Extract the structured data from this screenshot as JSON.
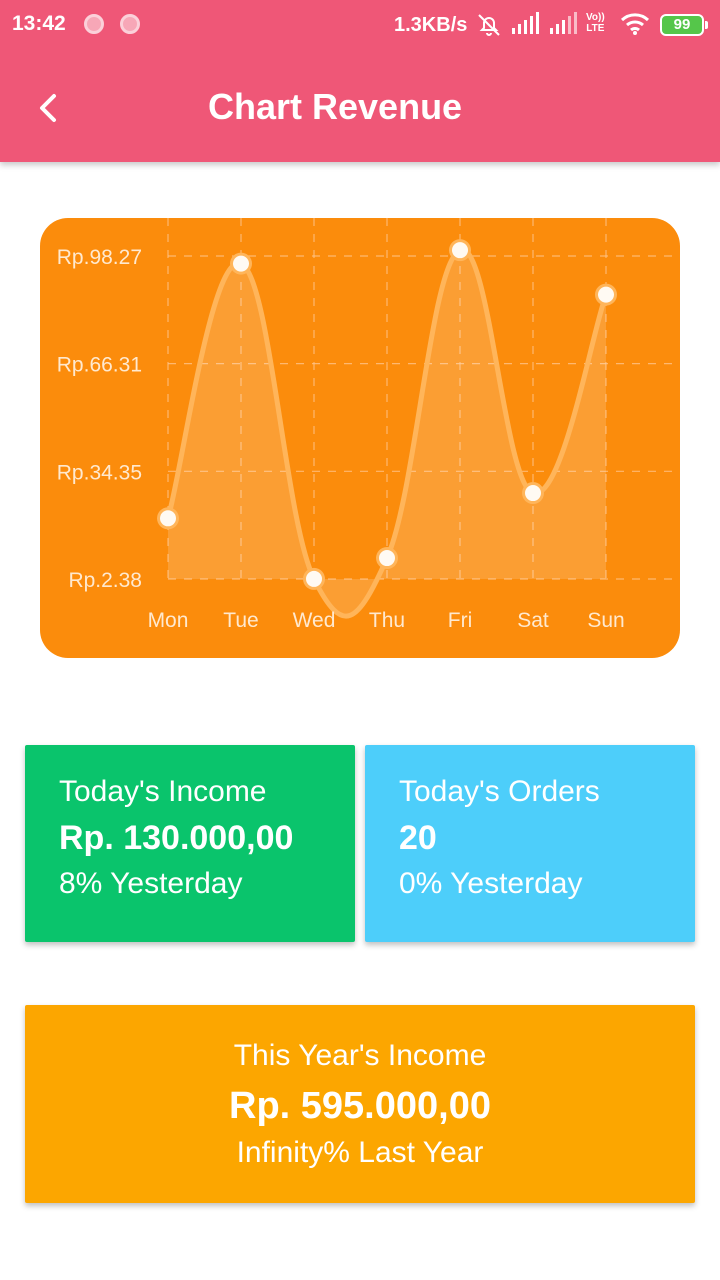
{
  "status_bar": {
    "time": "13:42",
    "network_speed": "1.3KB/s",
    "volte_label": "Vo)) LTE",
    "battery": "99",
    "icons": [
      "notification-dot-icon",
      "notification-dot-icon",
      "alarm-off-icon",
      "signal-icon",
      "signal-icon",
      "volte-icon",
      "wifi-icon",
      "battery-icon"
    ]
  },
  "app_bar": {
    "title": "Chart Revenue",
    "back_icon": "chevron-left-icon"
  },
  "colors": {
    "header": "#ef5777",
    "chart_background": "#fb8c0c",
    "income_card": "#0ac46c",
    "orders_card": "#4dcefa",
    "year_card": "#fca600"
  },
  "chart_data": {
    "type": "area",
    "categories": [
      "Mon",
      "Tue",
      "Wed",
      "Thu",
      "Fri",
      "Sat",
      "Sun"
    ],
    "y_tick_labels": [
      "Rp.2.38",
      "Rp.34.35",
      "Rp.66.31",
      "Rp.98.27"
    ],
    "y_ticks": [
      2.38,
      34.35,
      66.31,
      98.27
    ],
    "ylim": [
      2.38,
      98.27
    ],
    "values": [
      20.4,
      96.0,
      2.4,
      8.6,
      100.0,
      27.9,
      86.8
    ],
    "grid": true,
    "smooth": true
  },
  "cards": {
    "income": {
      "title": "Today's Income",
      "value": "Rp. 130.000,00",
      "sub": "8% Yesterday"
    },
    "orders": {
      "title": "Today's Orders",
      "value": "20",
      "sub": "0% Yesterday"
    },
    "year": {
      "title": "This Year's Income",
      "value": "Rp. 595.000,00",
      "sub": "Infinity% Last Year"
    }
  }
}
